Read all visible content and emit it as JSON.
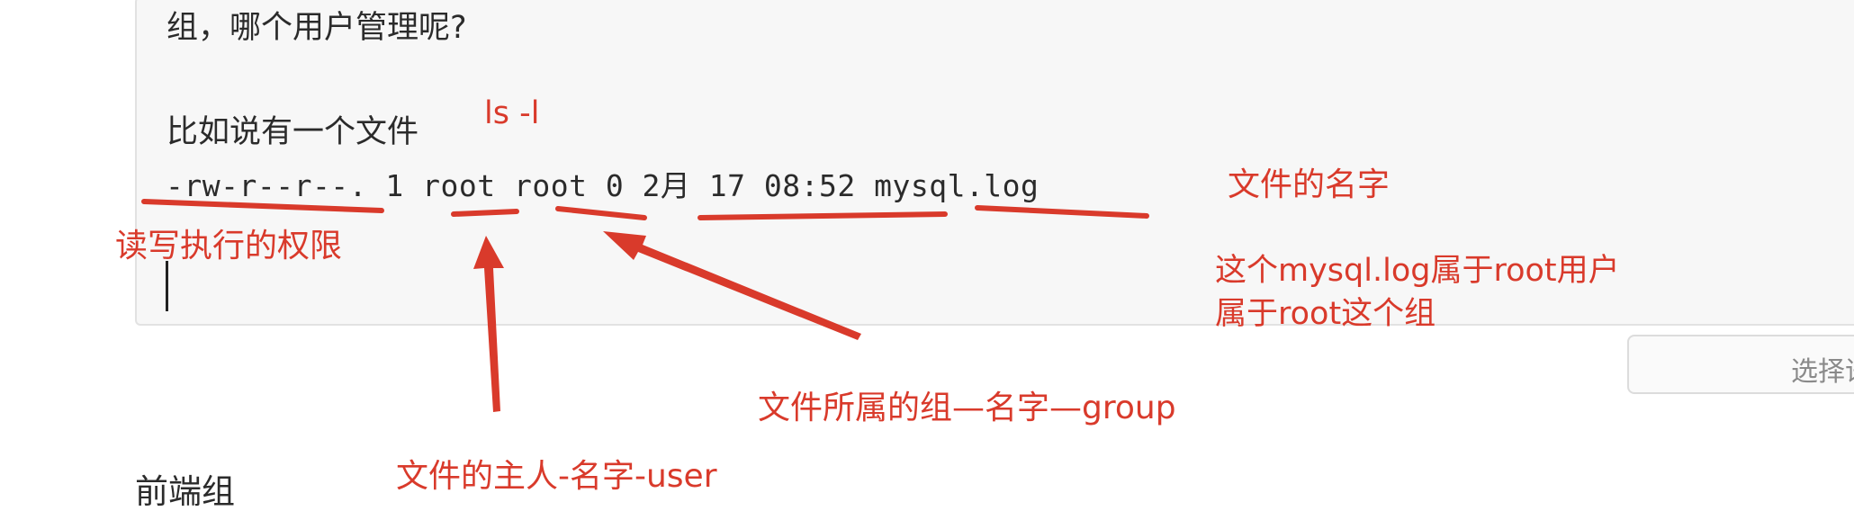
{
  "editor": {
    "line1": "组，哪个用户管理呢?",
    "line2": "比如说有一个文件",
    "command_line": "-rw-r--r--. 1 root root 0 2月  17 08:52 mysql.log"
  },
  "annotations": {
    "ls_command": "ls -l",
    "filename_label": "文件的名字",
    "permissions_label": "读写执行的权限",
    "ownership_line1": "这个mysql.log属于root用户",
    "ownership_line2": "属于root这个组",
    "group_label": "文件所属的组—名字—group",
    "owner_label": "文件的主人-名字-user"
  },
  "side_button": {
    "label": "选择语"
  },
  "section_title": "前端组",
  "colors": {
    "annotation_red": "#d93a2b",
    "text": "#2b2b2b",
    "editor_bg": "#f7f7f7"
  }
}
